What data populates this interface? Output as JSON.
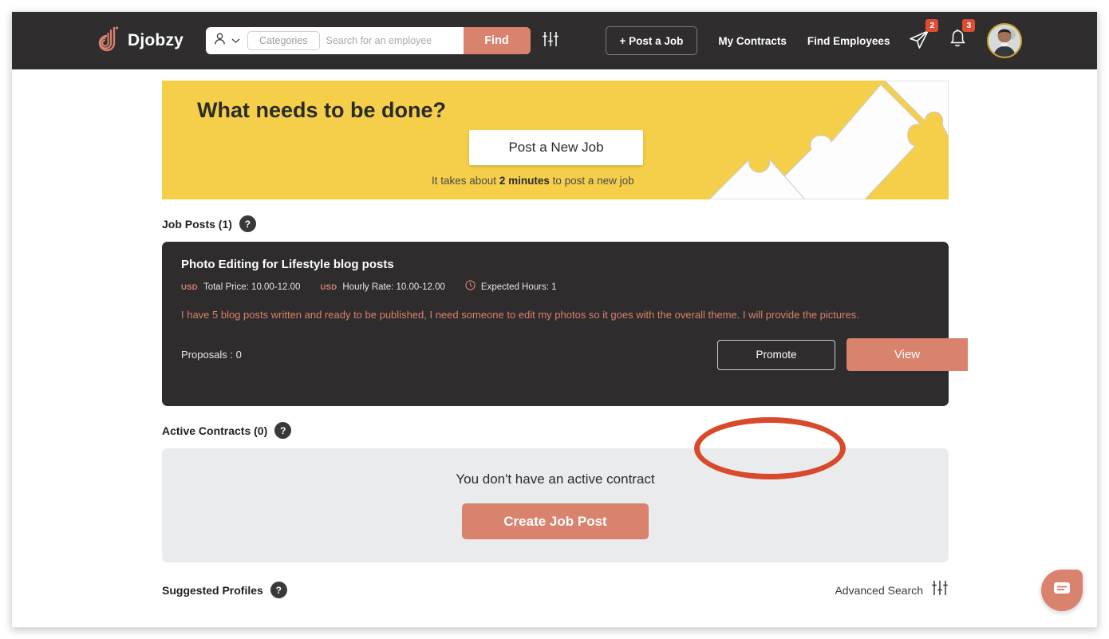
{
  "header": {
    "brand": "Djobzy",
    "brand_logo_icon": "djobzy-logo-icon",
    "user_type_icon": "person-icon",
    "user_type_chevron_icon": "chevron-down-icon",
    "categories_label": "Categories",
    "search_placeholder": "Search for an employee",
    "search_value": "",
    "find_label": "Find",
    "filter_icon": "sliders-icon",
    "post_a_job_label": "+ Post a Job",
    "nav": [
      {
        "label": "My Contracts"
      },
      {
        "label": "Find Employees"
      }
    ],
    "messages_icon": "send-icon",
    "messages_badge": "2",
    "notifications_icon": "bell-icon",
    "notifications_badge": "3",
    "avatar_name": "avatar"
  },
  "banner": {
    "title": "What needs to be done?",
    "cta_label": "Post a New Job",
    "subtext_prefix": "It takes about ",
    "subtext_bold": "2 minutes",
    "subtext_suffix": " to post a new job"
  },
  "job_posts_section": {
    "title": "Job Posts (1)",
    "help_icon_label": "?"
  },
  "job_card": {
    "title": "Photo Editing for Lifestyle blog posts",
    "currency_total": "USD",
    "total_price": "Total Price: 10.00-12.00",
    "currency_hourly": "USD",
    "hourly_rate": "Hourly Rate: 10.00-12.00",
    "clock_icon": "clock-icon",
    "expected_hours": "Expected Hours: 1",
    "description": "I have 5 blog posts written and ready to be published, I need someone to edit my photos so it goes with the overall theme. I will provide the pictures.",
    "proposals": "Proposals : 0",
    "promote_label": "Promote",
    "view_label": "View"
  },
  "active_contracts_section": {
    "title": "Active Contracts (0)",
    "help_icon_label": "?",
    "empty_message": "You don't have an active contract",
    "create_label": "Create Job Post"
  },
  "suggested_profiles_section": {
    "title": "Suggested Profiles",
    "help_icon_label": "?",
    "advanced_search_label": "Advanced Search",
    "advanced_search_icon": "sliders-icon"
  },
  "chat": {
    "icon": "chat-bubble-icon"
  },
  "colors": {
    "accent": "#d9826e",
    "header_bg": "#2f2d2d",
    "banner_bg": "#f5cf4a",
    "card_bg": "#2e2c2c",
    "empty_bg": "#eaebec",
    "badge": "#dd4d33",
    "annotation": "#d9492c"
  }
}
